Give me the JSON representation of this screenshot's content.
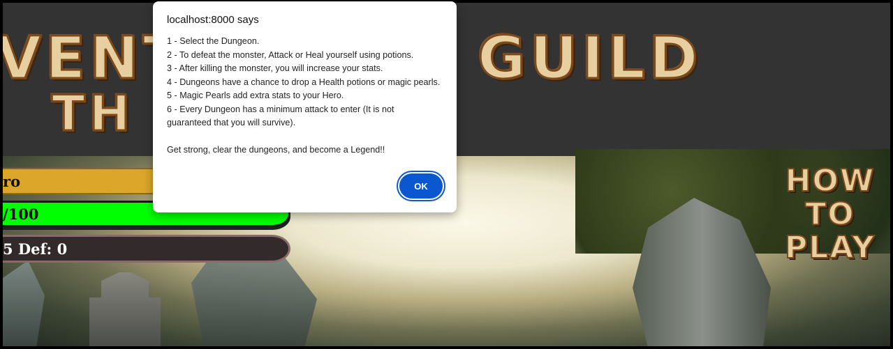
{
  "header": {
    "title_left": "VENT",
    "title_right": "GUILD",
    "title_the": "TH"
  },
  "hud": {
    "name": "ro",
    "health": "/100",
    "stats": "5 Def: 0",
    "colors": {
      "name_bar": "#dba62a",
      "health_bar": "#00ff00",
      "stats_bar": "#332b2b"
    }
  },
  "how_to_play": {
    "line1": "HOW",
    "line2": "TO",
    "line3": "PLAY"
  },
  "dialog": {
    "title": "localhost:8000 says",
    "lines": [
      "1 - Select the Dungeon.",
      "2 - To defeat the monster, Attack or Heal yourself using potions.",
      "3 - After killing the monster, you will increase your stats.",
      "4 - Dungeons have a chance to drop a Health potions or magic pearls.",
      "5 - Magic Pearls add extra stats to your Hero.",
      "6 - Every Dungeon has a minimum attack to enter (It is not",
      "guaranteed that you will survive)."
    ],
    "closing": "Get strong, clear the dungeons, and become a Legend!!",
    "ok_label": "OK",
    "accent": "#0b57d0"
  }
}
